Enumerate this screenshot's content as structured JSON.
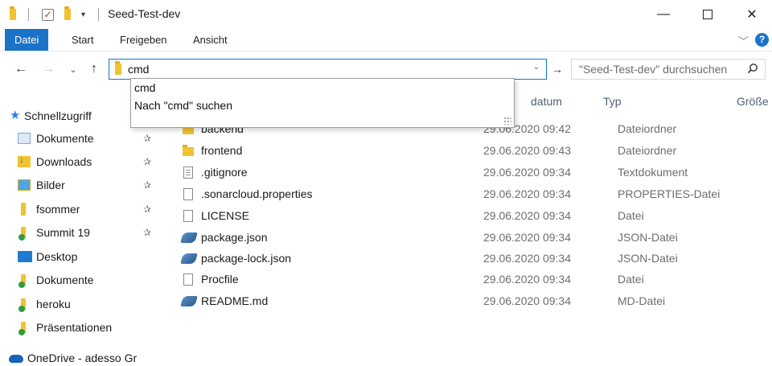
{
  "window": {
    "title": "Seed-Test-dev",
    "qat_check": "✓",
    "qat_arrow": "▾",
    "minimize": "—",
    "close": "✕"
  },
  "ribbon": {
    "tabs": [
      "Datei",
      "Start",
      "Freigeben",
      "Ansicht"
    ],
    "chevron": "﹀",
    "help": "?"
  },
  "address": {
    "back": "←",
    "forward": "→",
    "recent": "⌄",
    "up": "↑",
    "value": "cmd",
    "dropdown_arrow": "⌄",
    "refresh": "→",
    "search_placeholder": "\"Seed-Test-dev\" durchsuchen"
  },
  "autocomplete": {
    "items": [
      "cmd",
      "Nach \"cmd\" suchen"
    ]
  },
  "nav": {
    "quick_access": "Schnellzugriff",
    "pin": "📌",
    "items": [
      {
        "label": "Dokumente",
        "pinned": true
      },
      {
        "label": "Downloads",
        "pinned": true
      },
      {
        "label": "Bilder",
        "pinned": true
      },
      {
        "label": "fsommer",
        "pinned": true
      },
      {
        "label": "Summit 19",
        "pinned": true
      },
      {
        "label": "Desktop",
        "pinned": false
      },
      {
        "label": "Dokumente",
        "pinned": false
      },
      {
        "label": "heroku",
        "pinned": false
      },
      {
        "label": "Präsentationen",
        "pinned": false
      }
    ],
    "onedrive": "OneDrive - adesso Gr"
  },
  "columns": {
    "date_partial": "datum",
    "type": "Typ",
    "size": "Größe"
  },
  "files": [
    {
      "name": "backend",
      "date": "29.06.2020 09:42",
      "type": "Dateiordner",
      "icon": "folder-icon"
    },
    {
      "name": "frontend",
      "date": "29.06.2020 09:43",
      "type": "Dateiordner",
      "icon": "folder-icon"
    },
    {
      "name": ".gitignore",
      "date": "29.06.2020 09:34",
      "type": "Textdokument",
      "icon": "text-file-icon"
    },
    {
      "name": ".sonarcloud.properties",
      "date": "29.06.2020 09:34",
      "type": "PROPERTIES-Datei",
      "icon": "file-icon"
    },
    {
      "name": "LICENSE",
      "date": "29.06.2020 09:34",
      "type": "Datei",
      "icon": "file-icon"
    },
    {
      "name": "package.json",
      "date": "29.06.2020 09:34",
      "type": "JSON-Datei",
      "icon": "json-file-icon"
    },
    {
      "name": "package-lock.json",
      "date": "29.06.2020 09:34",
      "type": "JSON-Datei",
      "icon": "json-file-icon"
    },
    {
      "name": "Procfile",
      "date": "29.06.2020 09:34",
      "type": "Datei",
      "icon": "file-icon"
    },
    {
      "name": "README.md",
      "date": "29.06.2020 09:34",
      "type": "MD-Datei",
      "icon": "json-file-icon"
    }
  ],
  "colors": {
    "accent": "#1a73c7",
    "folder": "#f1c232",
    "header_text": "#4c607a"
  }
}
